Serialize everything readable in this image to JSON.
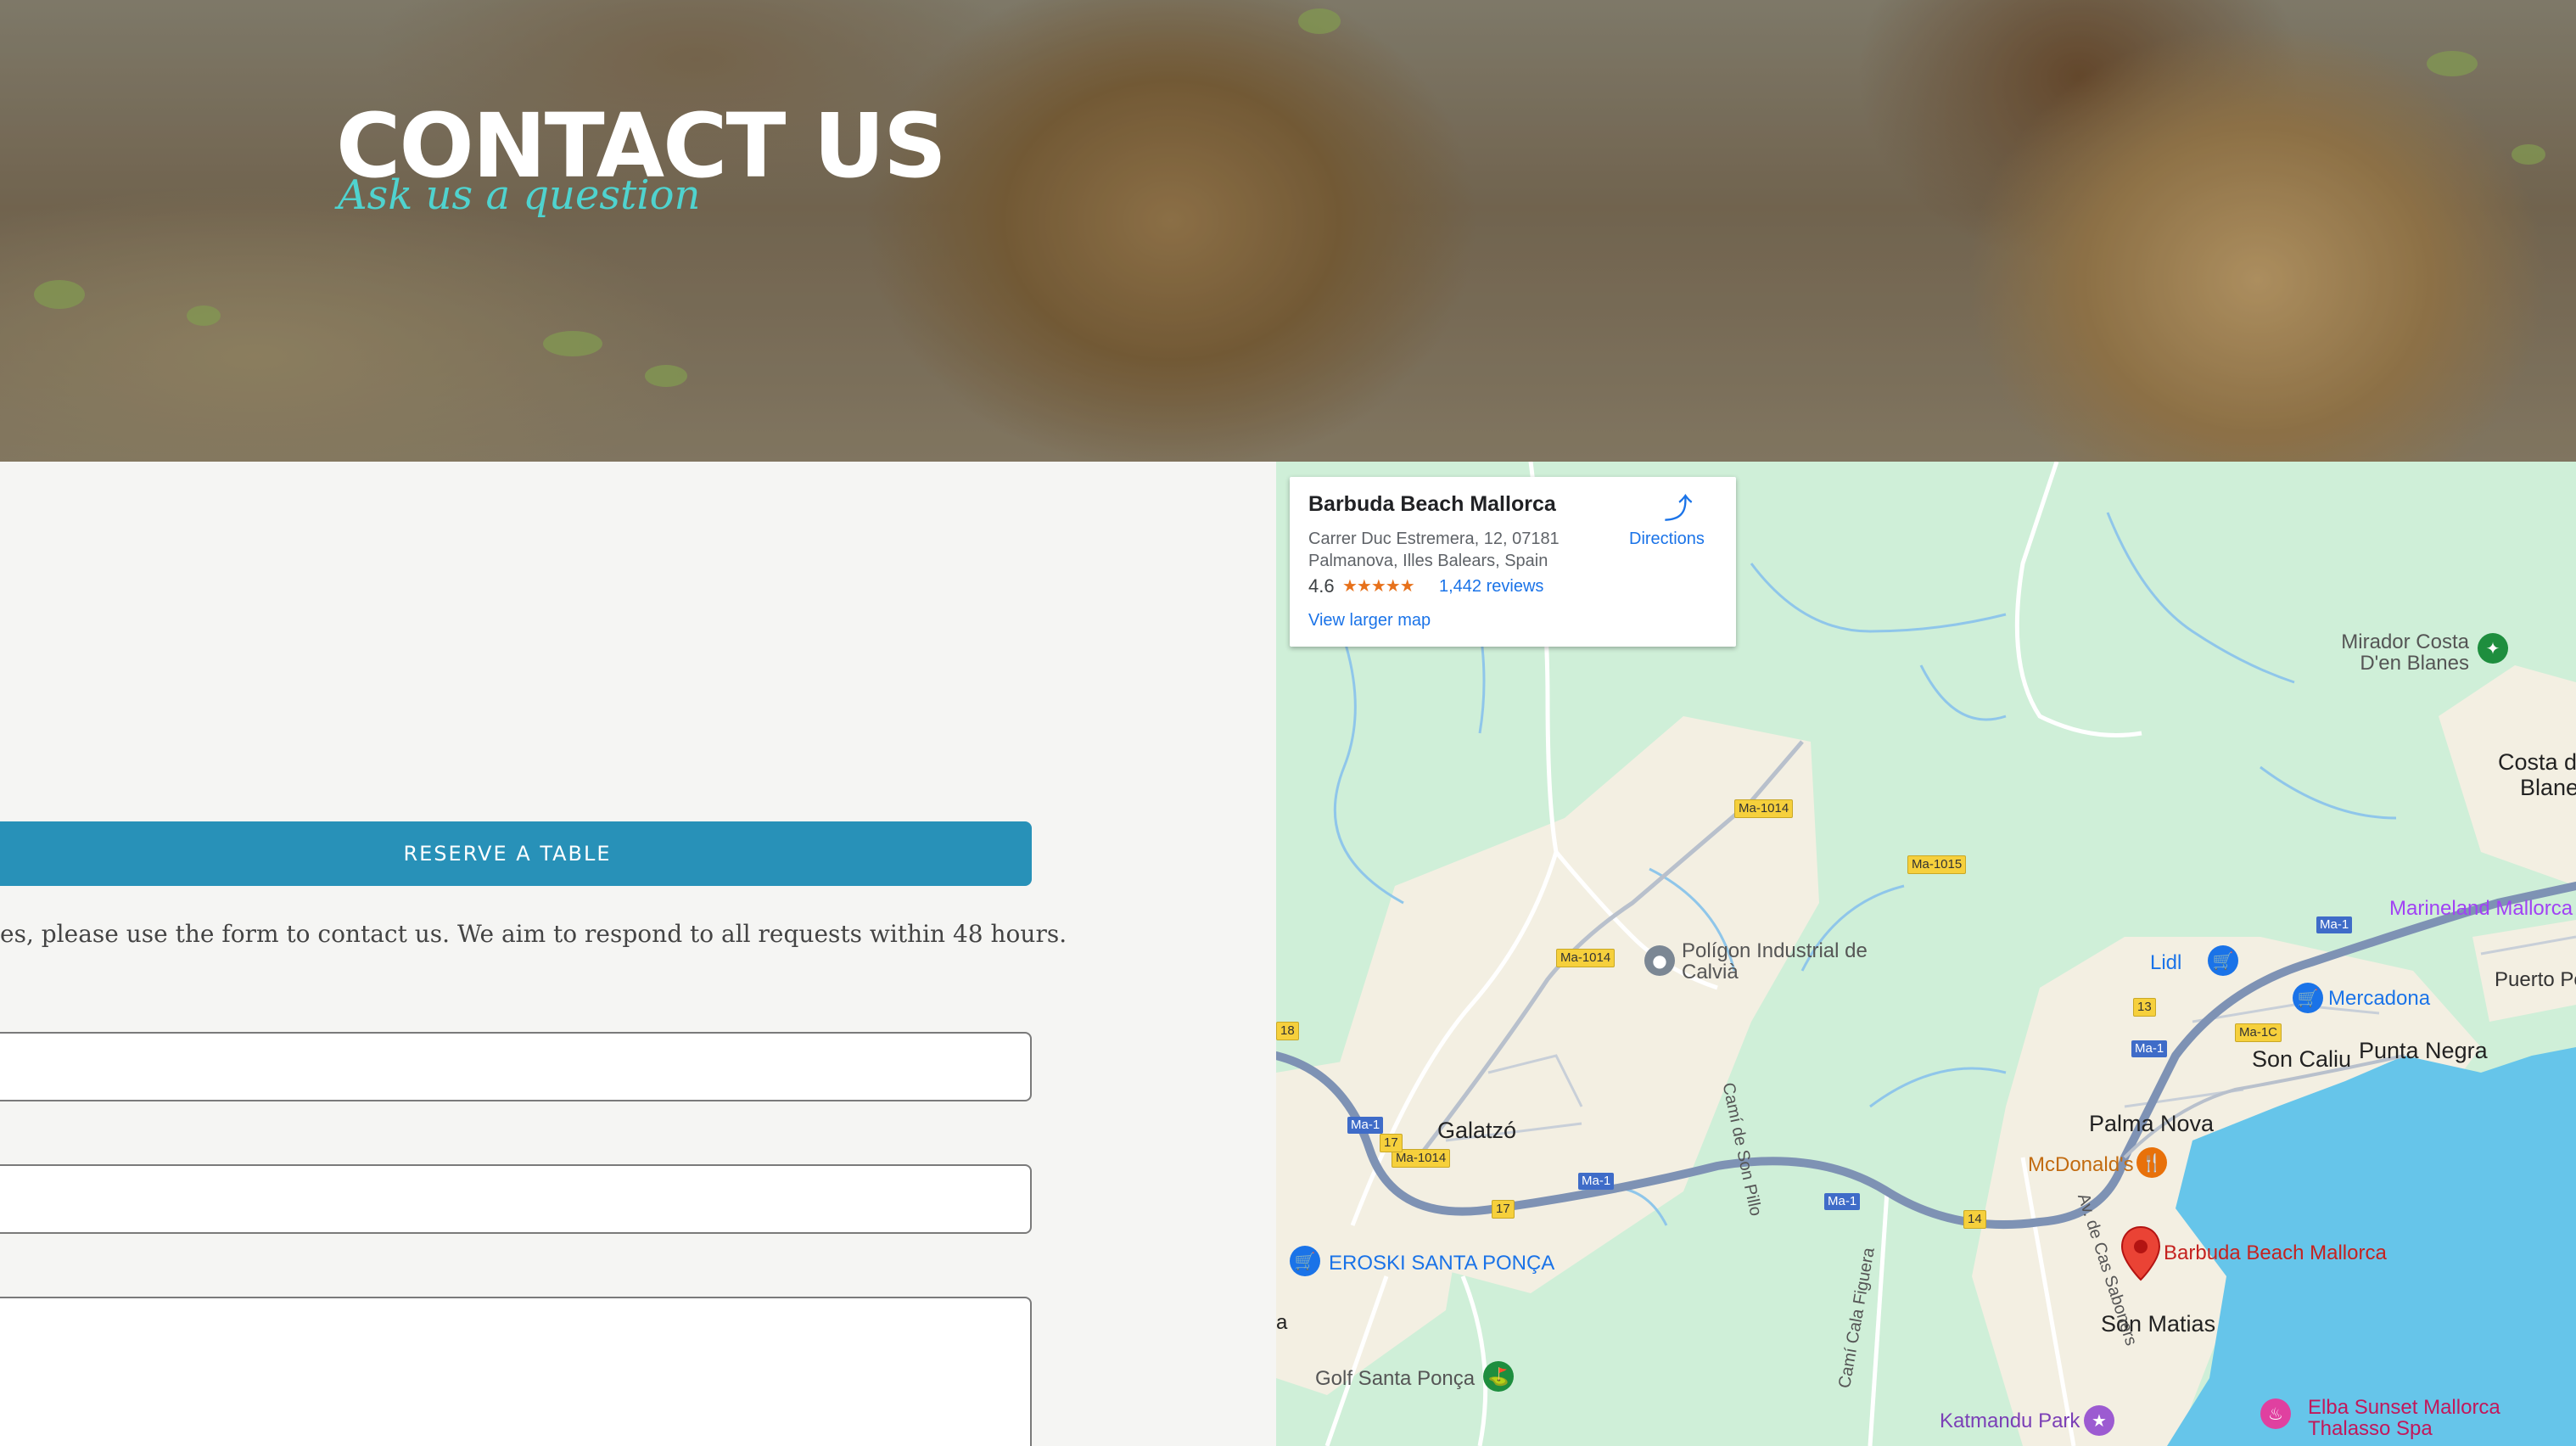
{
  "hero": {
    "title": "CONTACT US",
    "subtitle": "Ask us a question"
  },
  "contact": {
    "reserve_label": "RESERVE A TABLE",
    "intro": "es, please use the form to contact us. We aim to respond to all requests within 48 hours.",
    "button_color": "#2891b8"
  },
  "map": {
    "card": {
      "name": "Barbuda Beach Mallorca",
      "address_line1": "Carrer Duc Estremera, 12, 07181",
      "address_line2": "Palmanova, Illes Balears, Spain",
      "rating": "4.6",
      "stars": "★★★★★",
      "reviews": "1,442 reviews",
      "larger_map": "View larger map",
      "directions": "Directions"
    },
    "labels": {
      "mirador": "Mirador Costa D'en Blanes",
      "costa": "Costa d",
      "blane": "Blane",
      "marineland": "Marineland Mallorca",
      "lidl": "Lidl",
      "mercadona": "Mercadona",
      "puerto": "Puerto Po",
      "poligon": "Polígon Industrial de Calvià",
      "son_caliu": "Son Caliu",
      "punta_negra": "Punta Negra",
      "galatzo": "Galatzó",
      "palma_nova": "Palma Nova",
      "mcdonalds": "McDonald's",
      "barbuda": "Barbuda Beach Mallorca",
      "eroski": "EROSKI SANTA PONÇA",
      "son_matias": "Son Matias",
      "golf": "Golf Santa Ponça",
      "katmandu": "Katmandu Park",
      "elba": "Elba Sunset Mallorca Thalasso Spa",
      "cami_son_pillo": "Camí de Son Pillo",
      "cami_cala_figuera": "Camí Cala Figuera",
      "av_cas_saboners": "Av. de Cas Saboners",
      "left_edge": "a"
    },
    "shields": {
      "ma1014_a": "Ma-1014",
      "ma1015": "Ma-1015",
      "ma1014_b": "Ma-1014",
      "ma1_a": "Ma-1",
      "ma1_b": "Ma-1",
      "ma1_c": "Ma-1",
      "ma1_d": "Ma-1",
      "ma1_e": "Ma-1",
      "ma1c": "Ma-1C",
      "n13": "13",
      "n14": "14",
      "n17_a": "17",
      "n17_b": "17",
      "ma1014_c": "Ma-1014",
      "n18": "18"
    },
    "colors": {
      "land": "#cfefd8",
      "urban": "#f3efe2",
      "water": "#66c5ea",
      "highway": "#7e92b4",
      "pin": "#ea4335"
    }
  }
}
